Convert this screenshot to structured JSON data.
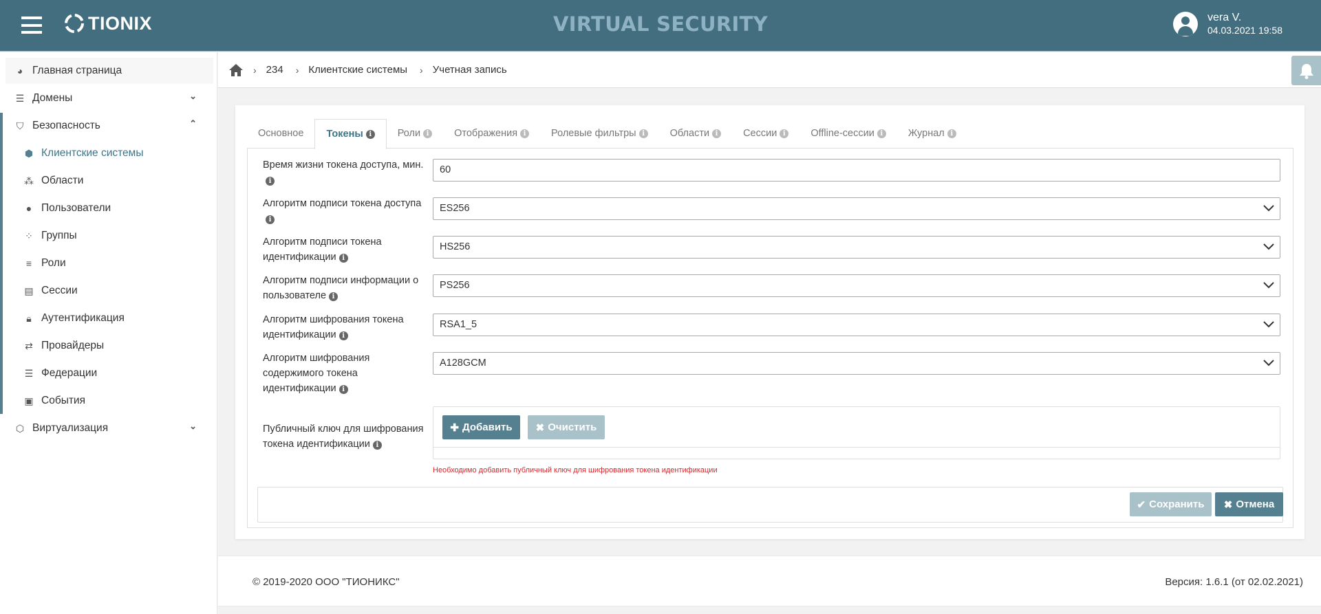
{
  "header": {
    "app_title": "VIRTUAL SECURITY",
    "logo_text": "TIONIX",
    "user_name": "vera V.",
    "datetime": "04.03.2021 19:58",
    "color": "#426e7f"
  },
  "sidebar": {
    "items": [
      {
        "label": "Главная страница",
        "icon": "dashboard-icon"
      },
      {
        "label": "Домены",
        "icon": "database-icon",
        "chevron": "down"
      },
      {
        "label": "Безопасность",
        "icon": "shield-icon",
        "chevron": "up"
      },
      {
        "label": "Клиентские системы",
        "icon": "cube-icon",
        "active": true
      },
      {
        "label": "Области",
        "icon": "cubes-icon"
      },
      {
        "label": "Пользователи",
        "icon": "user-icon"
      },
      {
        "label": "Группы",
        "icon": "users-icon"
      },
      {
        "label": "Роли",
        "icon": "list-icon"
      },
      {
        "label": "Сессии",
        "icon": "id-card-icon"
      },
      {
        "label": "Аутентификация",
        "icon": "lock-icon"
      },
      {
        "label": "Провайдеры",
        "icon": "exchange-icon"
      },
      {
        "label": "Федерации",
        "icon": "database-icon"
      },
      {
        "label": "События",
        "icon": "calendar-check-icon"
      },
      {
        "label": "Виртуализация",
        "icon": "codepen-icon",
        "chevron": "down"
      }
    ]
  },
  "breadcrumb": [
    "234",
    "Клиентские системы",
    "Учетная запись"
  ],
  "tabs": [
    {
      "label": "Основное",
      "info": false
    },
    {
      "label": "Токены",
      "info": true,
      "active": true
    },
    {
      "label": "Роли",
      "info": true
    },
    {
      "label": "Отображения",
      "info": true
    },
    {
      "label": "Ролевые фильтры",
      "info": true
    },
    {
      "label": "Области",
      "info": true
    },
    {
      "label": "Сессии",
      "info": true
    },
    {
      "label": "Offline-сессии",
      "info": true
    },
    {
      "label": "Журнал",
      "info": true
    }
  ],
  "form": {
    "fields": [
      {
        "label": "Время жизни токена доступа, мин.",
        "value": "60",
        "type": "input"
      },
      {
        "label": "Алгоритм подписи токена доступа",
        "value": "ES256",
        "type": "select"
      },
      {
        "label": "Алгоритм подписи токена идентификации",
        "value": "HS256",
        "type": "select"
      },
      {
        "label": "Алгоритм подписи информации о пользователе",
        "value": "PS256",
        "type": "select"
      },
      {
        "label": "Алгоритм шифрования токена идентификации",
        "value": "RSA1_5",
        "type": "select"
      },
      {
        "label": "Алгоритм шифрования содержимого токена идентификации",
        "value": "A128GCM",
        "type": "select"
      }
    ],
    "public_key": {
      "label": "Публичный ключ для шифрования токена идентификации",
      "add_label": "Добавить",
      "clear_label": "Очистить",
      "error": "Необходимо добавить публичный ключ для шифрования токена идентификации"
    },
    "save_label": "Сохранить",
    "cancel_label": "Отмена"
  },
  "footer": {
    "copyright": "© 2019-2020 ООО \"ТИОНИКС\"",
    "version": "Версия: 1.6.1 (от 02.02.2021)"
  }
}
